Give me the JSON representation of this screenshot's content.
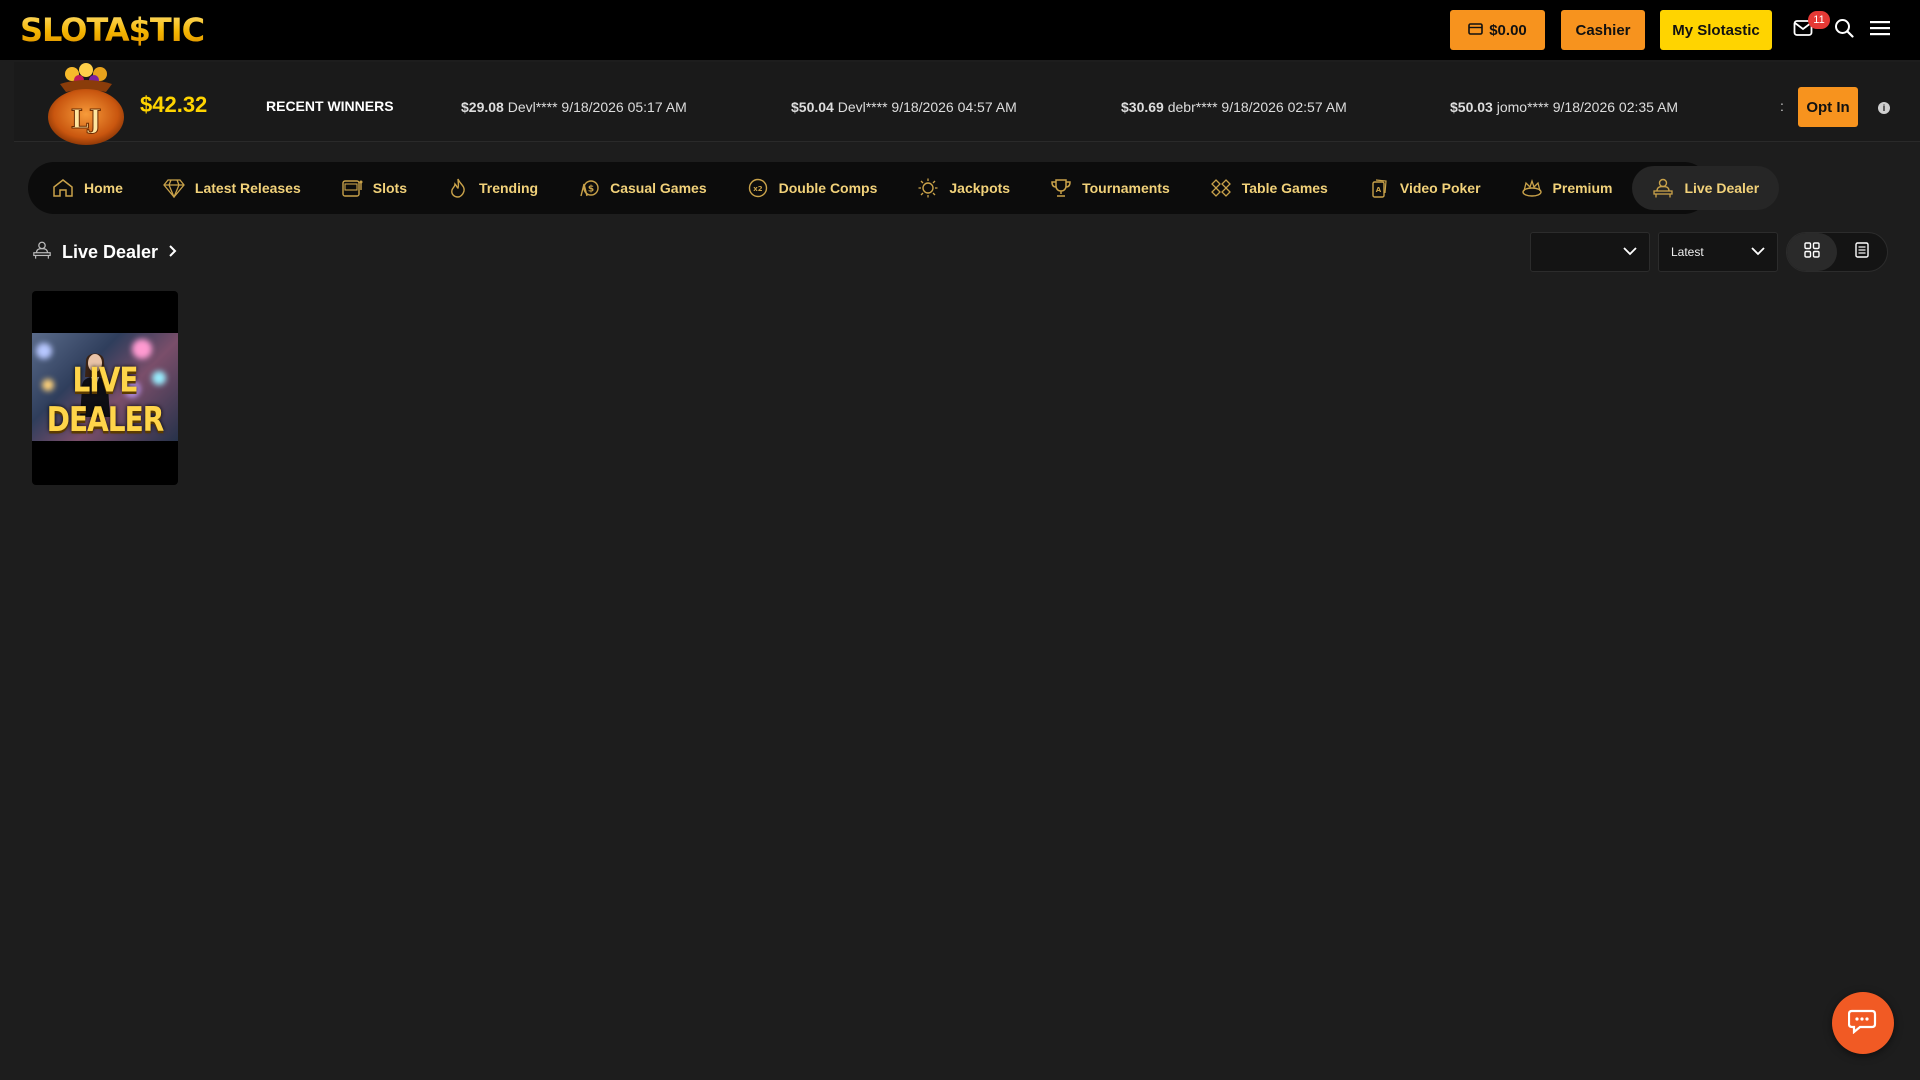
{
  "brand": {
    "logo_text": "SLOTA$TIC"
  },
  "header": {
    "balance_label": "$0.00",
    "cashier_label": "Cashier",
    "my_account_label": "My Slotastic",
    "mail_count": "11"
  },
  "jackpot": {
    "pot_letters": "LJ",
    "amount": "$42.32"
  },
  "recent_winners": {
    "title": "RECENT WINNERS",
    "items": [
      {
        "amount": "$29.08",
        "text": "Devl**** 9/18/2026 05:17 AM"
      },
      {
        "amount": "$50.04",
        "text": "Devl**** 9/18/2026 04:57 AM"
      },
      {
        "amount": "$30.69",
        "text": "debr**** 9/18/2026 02:57 AM"
      },
      {
        "amount": "$50.03",
        "text": "jomo**** 9/18/2026 02:35 AM"
      }
    ],
    "separator": ":",
    "opt_in_label": "Opt In"
  },
  "nav": {
    "items": [
      {
        "label": "Home",
        "icon": "home-icon"
      },
      {
        "label": "Latest Releases",
        "icon": "diamond-icon"
      },
      {
        "label": "Slots",
        "icon": "slot-machine-icon"
      },
      {
        "label": "Trending",
        "icon": "flame-icon"
      },
      {
        "label": "Casual Games",
        "icon": "casual-games-icon"
      },
      {
        "label": "Double Comps",
        "icon": "double-comps-icon"
      },
      {
        "label": "Jackpots",
        "icon": "jackpot-icon"
      },
      {
        "label": "Tournaments",
        "icon": "trophy-icon"
      },
      {
        "label": "Table Games",
        "icon": "table-games-icon"
      },
      {
        "label": "Video Poker",
        "icon": "video-poker-icon"
      },
      {
        "label": "Premium",
        "icon": "crown-icon"
      },
      {
        "label": "Live Dealer",
        "icon": "dealer-icon"
      }
    ],
    "active": "Live Dealer"
  },
  "section": {
    "title": "Live Dealer",
    "filter_value": "",
    "sort_value": "Latest"
  },
  "games": [
    {
      "label": "LIVE DEALER"
    }
  ],
  "colors": {
    "accent_orange": "#f7931e",
    "accent_yellow": "#ffd400",
    "nav_text": "#f2d27a",
    "background": "#1d1d1d"
  }
}
